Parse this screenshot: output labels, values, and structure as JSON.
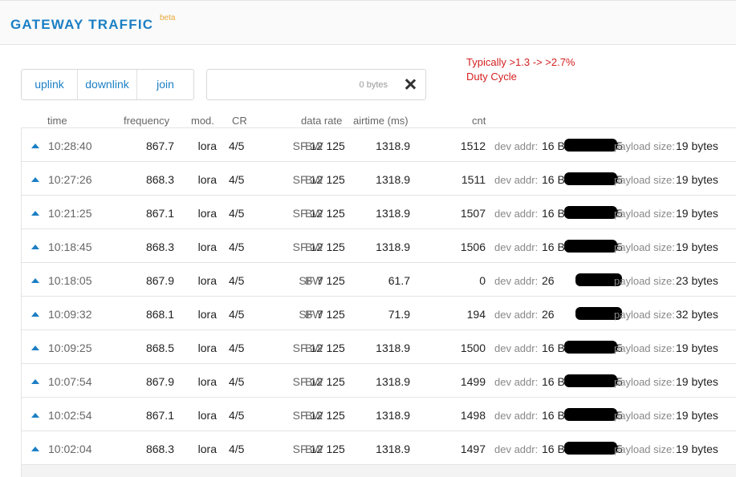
{
  "header": {
    "title": "GATEWAY TRAFFIC",
    "badge": "beta"
  },
  "annotation": {
    "line1": "Typically >1.3 -> >2.7%",
    "line2": "Duty Cycle"
  },
  "filters": {
    "uplink": "uplink",
    "downlink": "downlink",
    "join": "join"
  },
  "search": {
    "bytes": "0 bytes",
    "icon": "close-icon"
  },
  "columns": {
    "time": "time",
    "frequency": "frequency",
    "mod": "mod.",
    "cr": "CR",
    "data_rate": "data rate",
    "airtime": "airtime (ms)",
    "cnt": "cnt"
  },
  "labels": {
    "sf": "SF",
    "bw": "BW",
    "dev_addr": "dev addr:",
    "payload_size": "payload size:"
  },
  "rows": [
    {
      "direction": "up-arrow-icon",
      "time": "10:28:40",
      "frequency": "867.7",
      "mod": "lora",
      "cr": "4/5",
      "sf": "12",
      "bw": "125",
      "airtime": "1318.9",
      "cnt": "1512",
      "dev_addr": "16 B",
      "dev_addr_tail": "5",
      "payload": "19 bytes"
    },
    {
      "direction": "up-arrow-icon",
      "time": "10:27:26",
      "frequency": "868.3",
      "mod": "lora",
      "cr": "4/5",
      "sf": "12",
      "bw": "125",
      "airtime": "1318.9",
      "cnt": "1511",
      "dev_addr": "16 B",
      "dev_addr_tail": "5",
      "payload": "19 bytes"
    },
    {
      "direction": "up-arrow-icon",
      "time": "10:21:25",
      "frequency": "867.1",
      "mod": "lora",
      "cr": "4/5",
      "sf": "12",
      "bw": "125",
      "airtime": "1318.9",
      "cnt": "1507",
      "dev_addr": "16 B",
      "dev_addr_tail": "5",
      "payload": "19 bytes"
    },
    {
      "direction": "up-arrow-icon",
      "time": "10:18:45",
      "frequency": "868.3",
      "mod": "lora",
      "cr": "4/5",
      "sf": "12",
      "bw": "125",
      "airtime": "1318.9",
      "cnt": "1506",
      "dev_addr": "16 B",
      "dev_addr_tail": "5",
      "payload": "19 bytes"
    },
    {
      "direction": "up-arrow-icon",
      "time": "10:18:05",
      "frequency": "867.9",
      "mod": "lora",
      "cr": "4/5",
      "sf": "7",
      "bw": "125",
      "airtime": "61.7",
      "cnt": "0",
      "dev_addr": "26",
      "dev_addr_tail": "",
      "payload": "23 bytes"
    },
    {
      "direction": "up-arrow-icon",
      "time": "10:09:32",
      "frequency": "868.1",
      "mod": "lora",
      "cr": "4/5",
      "sf": "7",
      "bw": "125",
      "airtime": "71.9",
      "cnt": "194",
      "dev_addr": "26",
      "dev_addr_tail": "",
      "payload": "32 bytes"
    },
    {
      "direction": "up-arrow-icon",
      "time": "10:09:25",
      "frequency": "868.5",
      "mod": "lora",
      "cr": "4/5",
      "sf": "12",
      "bw": "125",
      "airtime": "1318.9",
      "cnt": "1500",
      "dev_addr": "16 B",
      "dev_addr_tail": "5",
      "payload": "19 bytes"
    },
    {
      "direction": "up-arrow-icon",
      "time": "10:07:54",
      "frequency": "867.9",
      "mod": "lora",
      "cr": "4/5",
      "sf": "12",
      "bw": "125",
      "airtime": "1318.9",
      "cnt": "1499",
      "dev_addr": "16 B",
      "dev_addr_tail": "5",
      "payload": "19 bytes"
    },
    {
      "direction": "up-arrow-icon",
      "time": "10:02:54",
      "frequency": "867.1",
      "mod": "lora",
      "cr": "4/5",
      "sf": "12",
      "bw": "125",
      "airtime": "1318.9",
      "cnt": "1498",
      "dev_addr": "16 B",
      "dev_addr_tail": "5",
      "payload": "19 bytes"
    },
    {
      "direction": "up-arrow-icon",
      "time": "10:02:04",
      "frequency": "868.3",
      "mod": "lora",
      "cr": "4/5",
      "sf": "12",
      "bw": "125",
      "airtime": "1318.9",
      "cnt": "1497",
      "dev_addr": "16 B",
      "dev_addr_tail": "5",
      "payload": "19 bytes"
    }
  ],
  "colors": {
    "accent": "#1b7fc4",
    "annotation": "#d42020",
    "badge": "#e8a93a"
  }
}
